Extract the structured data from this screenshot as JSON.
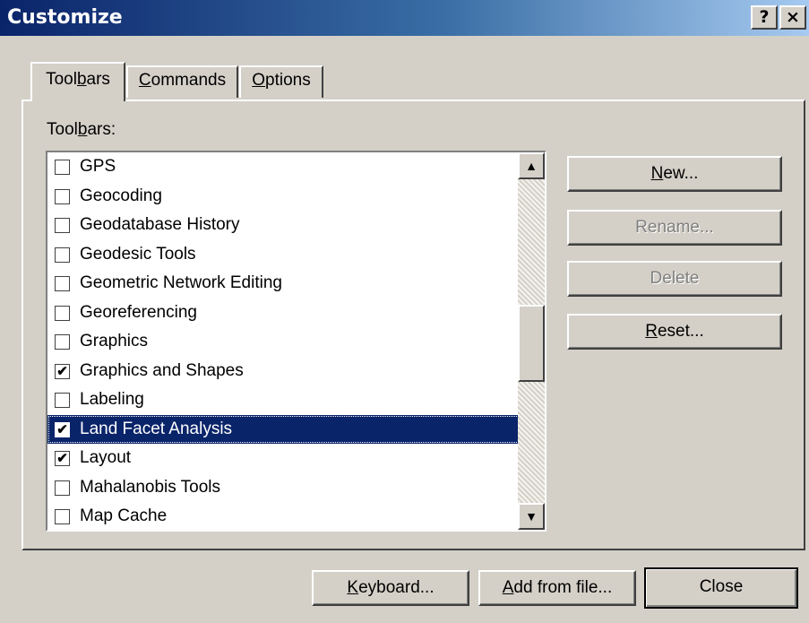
{
  "window": {
    "title": "Customize",
    "help_glyph": "?",
    "close_glyph": "×"
  },
  "tabs": [
    {
      "pre": "Tool",
      "key": "b",
      "post": "ars"
    },
    {
      "pre": "",
      "key": "C",
      "post": "ommands"
    },
    {
      "pre": "",
      "key": "O",
      "post": "ptions"
    }
  ],
  "panel": {
    "label_pre": "Tool",
    "label_key": "b",
    "label_post": "ars:"
  },
  "toolbars_list": [
    {
      "label": "GPS",
      "checked": false,
      "selected": false
    },
    {
      "label": "Geocoding",
      "checked": false,
      "selected": false
    },
    {
      "label": "Geodatabase History",
      "checked": false,
      "selected": false
    },
    {
      "label": "Geodesic Tools",
      "checked": false,
      "selected": false
    },
    {
      "label": "Geometric Network Editing",
      "checked": false,
      "selected": false
    },
    {
      "label": "Georeferencing",
      "checked": false,
      "selected": false
    },
    {
      "label": "Graphics",
      "checked": false,
      "selected": false
    },
    {
      "label": "Graphics and Shapes",
      "checked": true,
      "selected": false
    },
    {
      "label": "Labeling",
      "checked": false,
      "selected": false
    },
    {
      "label": "Land Facet Analysis",
      "checked": true,
      "selected": true
    },
    {
      "label": "Layout",
      "checked": true,
      "selected": false
    },
    {
      "label": "Mahalanobis Tools",
      "checked": false,
      "selected": false
    },
    {
      "label": "Map Cache",
      "checked": false,
      "selected": false
    }
  ],
  "scrollbar": {
    "up_glyph": "▲",
    "down_glyph": "▼"
  },
  "side_buttons": {
    "new": {
      "key": "N",
      "post": "ew..."
    },
    "rename": {
      "label": "Rename..."
    },
    "delete": {
      "label": "Delete"
    },
    "reset": {
      "key": "R",
      "post": "eset..."
    }
  },
  "bottom_buttons": {
    "keyboard": {
      "key": "K",
      "post": "eyboard..."
    },
    "add_from_file": {
      "key": "A",
      "post": "dd from file..."
    },
    "close": {
      "label": "Close"
    }
  },
  "check_glyph": "✔"
}
